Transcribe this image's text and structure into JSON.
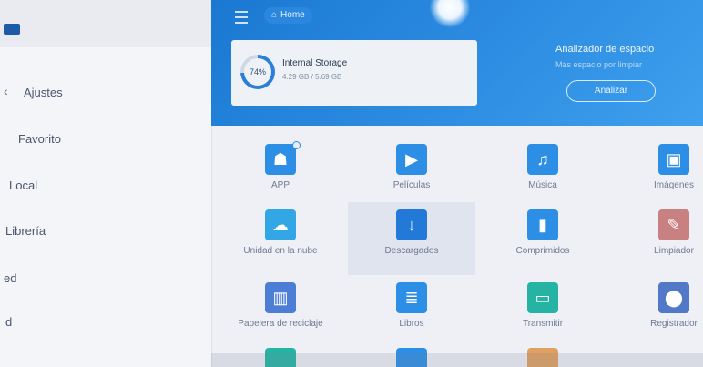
{
  "sidebar": {
    "items": [
      {
        "label": "Ajustes",
        "chevron": "‹"
      },
      {
        "label": "Favorito"
      },
      {
        "label": "Local"
      },
      {
        "label": "Librería"
      },
      {
        "label": "ed"
      },
      {
        "label": "d"
      }
    ]
  },
  "header": {
    "breadcrumb": "Home",
    "breadcrumb_icon": "home-icon",
    "storage": {
      "percent": "74%",
      "title": "Internal Storage",
      "subtitle": "4.29 GB / 5.69 GB"
    },
    "analyzer": {
      "title": "Analizador de espacio",
      "subtitle": "Más espacio por limpiar",
      "button": "Analizar"
    },
    "colors": {
      "accent": "#1a78d2",
      "accent_light": "#3ea0ee"
    }
  },
  "categories": [
    {
      "label": "APP",
      "icon": "android-icon",
      "color": "#2c8ee4",
      "badge": true
    },
    {
      "label": "Películas",
      "icon": "video-icon",
      "color": "#2c8ee4"
    },
    {
      "label": "Música",
      "icon": "music-icon",
      "color": "#2c8ee4"
    },
    {
      "label": "Imágenes",
      "icon": "image-icon",
      "color": "#2c8ee4"
    },
    {
      "label": "Unidad en la nube",
      "icon": "cloud-icon",
      "color": "#33a6e6"
    },
    {
      "label": "Descargados",
      "icon": "download-icon",
      "color": "#2379d8",
      "selected": true
    },
    {
      "label": "Comprimidos",
      "icon": "archive-icon",
      "color": "#2c8ee4"
    },
    {
      "label": "Limpiador",
      "icon": "broom-icon",
      "color": "#c98080"
    },
    {
      "label": "Papelera de reciclaje",
      "icon": "trash-icon",
      "color": "#4d7ed6"
    },
    {
      "label": "Libros",
      "icon": "book-icon",
      "color": "#2c8ee4"
    },
    {
      "label": "Transmitir",
      "icon": "cast-icon",
      "color": "#25b4a4"
    },
    {
      "label": "Registrador",
      "icon": "recorder-icon",
      "color": "#5278c8"
    }
  ]
}
